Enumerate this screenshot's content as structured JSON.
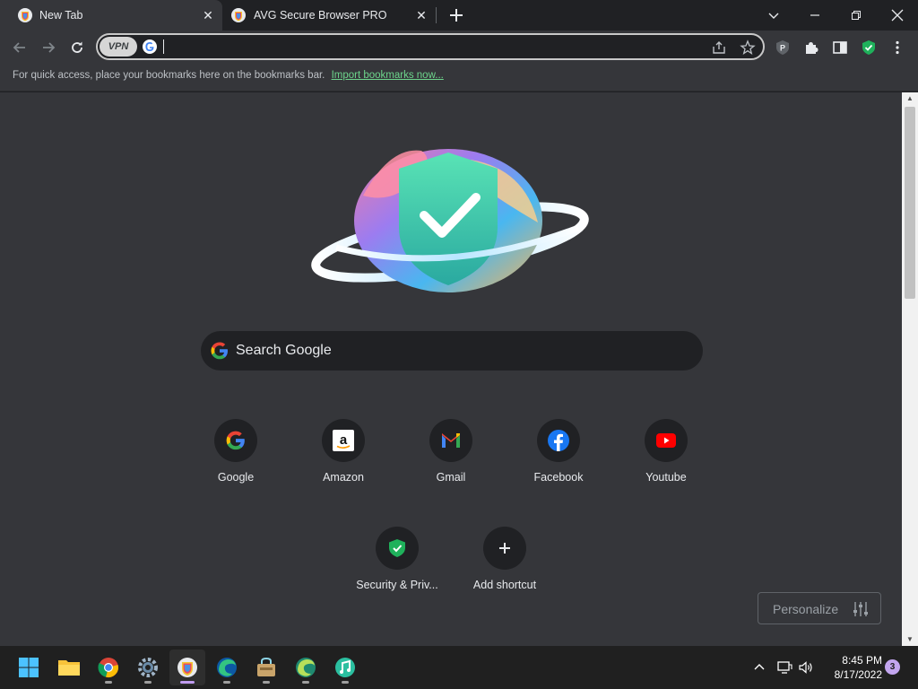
{
  "tabs": [
    {
      "title": "New Tab",
      "active": true,
      "icon": "avg-browser-icon"
    },
    {
      "title": "AVG Secure Browser PRO",
      "active": false,
      "icon": "avg-browser-icon"
    }
  ],
  "toolbar": {
    "vpn_label": "VPN",
    "omnibox_value": "",
    "icons": [
      "back-icon",
      "forward-icon",
      "reload-icon",
      "share-icon",
      "bookmark-star-icon",
      "privacy-extension-icon",
      "extensions-puzzle-icon",
      "side-panel-icon",
      "avg-shield-icon",
      "more-menu-icon"
    ]
  },
  "bookmarks_bar": {
    "message": "For quick access, place your bookmarks here on the bookmarks bar.",
    "link": "Import bookmarks now..."
  },
  "newtab": {
    "search_placeholder": "Search Google",
    "shortcuts": [
      {
        "label": "Google",
        "icon": "google-icon"
      },
      {
        "label": "Amazon",
        "icon": "amazon-icon"
      },
      {
        "label": "Gmail",
        "icon": "gmail-icon"
      },
      {
        "label": "Facebook",
        "icon": "facebook-icon"
      },
      {
        "label": "Youtube",
        "icon": "youtube-icon"
      },
      {
        "label": "Security & Priv...",
        "icon": "security-shield-icon"
      },
      {
        "label": "Add shortcut",
        "icon": "plus-icon"
      }
    ],
    "personalize_label": "Personalize"
  },
  "colors": {
    "accent": "#6dd58c",
    "avg_green": "#1fb15b",
    "background": "#35363a",
    "frame": "#202124"
  },
  "taskbar": {
    "apps": [
      "windows-start-icon",
      "file-explorer-icon",
      "chrome-icon",
      "settings-icon",
      "avg-browser-icon",
      "edge-icon",
      "store-icon",
      "edge-beta-icon",
      "music-app-icon"
    ],
    "time": "8:45 PM",
    "date": "8/17/2022",
    "notification_count": "3"
  }
}
